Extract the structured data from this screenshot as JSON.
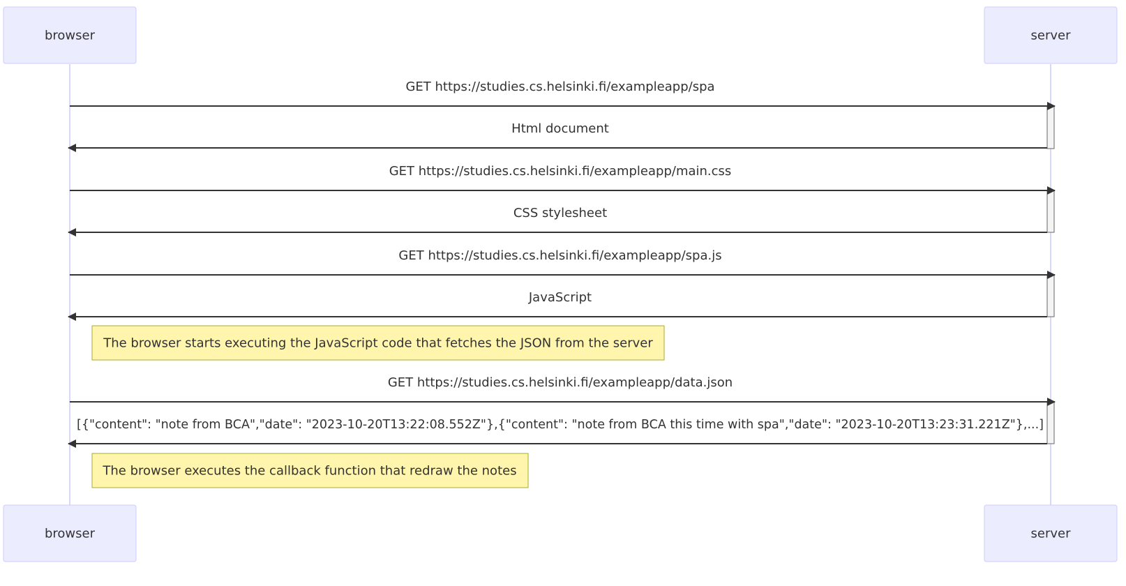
{
  "participants": [
    {
      "id": "browser",
      "label": "browser"
    },
    {
      "id": "server",
      "label": "server"
    }
  ],
  "messages": [
    {
      "from": "browser",
      "to": "server",
      "label": "GET https://studies.cs.helsinki.fi/exampleapp/spa"
    },
    {
      "from": "server",
      "to": "browser",
      "label": "Html document"
    },
    {
      "from": "browser",
      "to": "server",
      "label": "GET https://studies.cs.helsinki.fi/exampleapp/main.css"
    },
    {
      "from": "server",
      "to": "browser",
      "label": "CSS stylesheet"
    },
    {
      "from": "browser",
      "to": "server",
      "label": "GET https://studies.cs.helsinki.fi/exampleapp/spa.js"
    },
    {
      "from": "server",
      "to": "browser",
      "label": "JavaScript"
    },
    {
      "from": "browser",
      "to": "server",
      "label": "GET https://studies.cs.helsinki.fi/exampleapp/data.json"
    },
    {
      "from": "server",
      "to": "browser",
      "label": "[{\"content\": \"note from BCA\",\"date\": \"2023-10-20T13:22:08.552Z\"},{\"content\": \"note from BCA this time with spa\",\"date\": \"2023-10-20T13:23:31.221Z\"},...]"
    }
  ],
  "notes": [
    {
      "text": "The browser starts executing the JavaScript code that fetches the JSON from the server"
    },
    {
      "text": "The browser executes the callback function that redraw the notes"
    }
  ],
  "colors": {
    "actor_fill": "#ECECFF",
    "actor_border": "#CCCCFF",
    "lifeline": "#CCCCFF",
    "arrow": "#333333",
    "text": "#333333",
    "note_fill": "#FFF5AD",
    "note_border": "#AAAA33",
    "activation_fill": "#F4F4F4",
    "activation_border": "#666666"
  }
}
